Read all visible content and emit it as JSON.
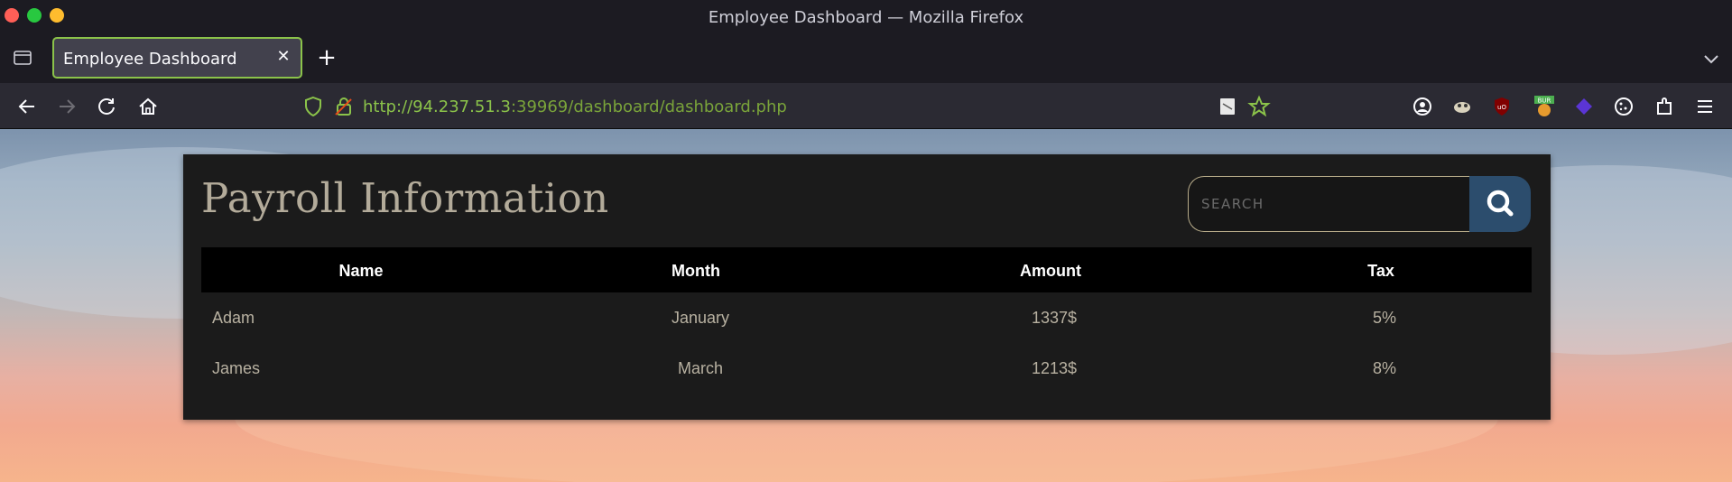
{
  "window": {
    "title": "Employee Dashboard — Mozilla Firefox",
    "colors": {
      "close": "#ff5f57",
      "minimize": "#28c840",
      "maximize": "#febc2e"
    }
  },
  "tabs": [
    {
      "label": "Employee Dashboard",
      "active": true
    }
  ],
  "navbar": {
    "url_host": "http://94.237.51.3",
    "url_rest": ":39969/dashboard/dashboard.php",
    "icons": [
      "back-icon",
      "forward-icon",
      "reload-icon",
      "home-icon",
      "shield-icon",
      "lock-icon",
      "reader-icon",
      "bookmark-star-icon",
      "account-icon",
      "extension-icon",
      "ublock-icon",
      "burp-icon",
      "wappalyzer-icon",
      "cookie-icon",
      "extensions-icon",
      "menu-icon"
    ]
  },
  "page": {
    "title": "Payroll Information",
    "search": {
      "placeholder": "SEARCH",
      "value": ""
    },
    "table": {
      "headers": [
        "Name",
        "Month",
        "Amount",
        "Tax"
      ],
      "rows": [
        [
          "Adam",
          "January",
          "1337$",
          "5%"
        ],
        [
          "James",
          "March",
          "1213$",
          "8%"
        ]
      ]
    },
    "colors": {
      "accent": "#2c4d6d",
      "title": "#b3ab9a",
      "url_green": "#8bc34a"
    }
  }
}
